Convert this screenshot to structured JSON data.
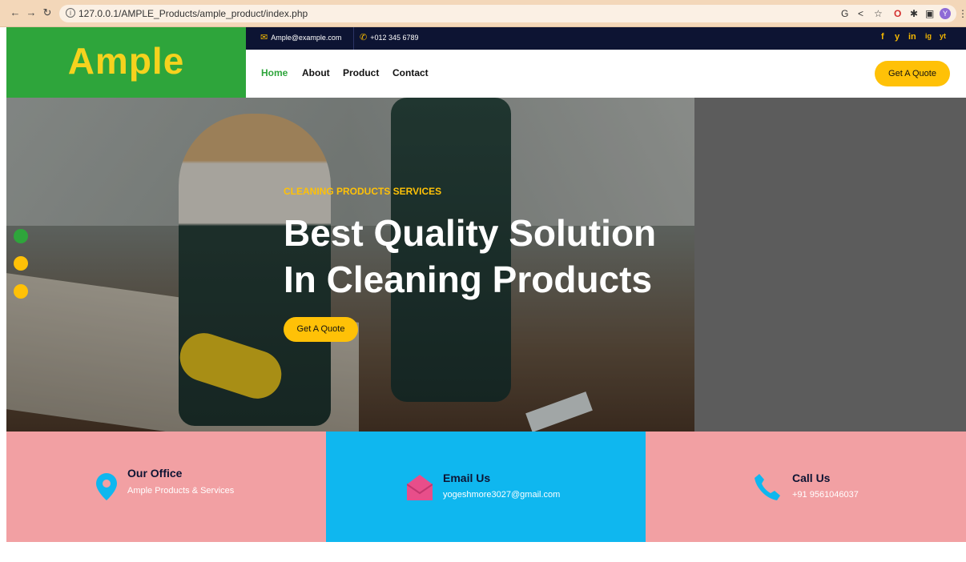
{
  "browser": {
    "url": "127.0.0.1/AMPLE_Products/ample_product/index.php",
    "avatar_initial": "Y"
  },
  "site": {
    "logo": "Ample",
    "topbar": {
      "email": "Ample@example.com",
      "phone": "+012 345 6789",
      "social": [
        "f",
        "y",
        "in",
        "ig",
        "yt"
      ]
    },
    "nav": {
      "links": [
        "Home",
        "About",
        "Product",
        "Contact"
      ],
      "active": "Home",
      "cta": "Get A Quote"
    },
    "hero": {
      "subtitle": "CLEANING PRODUCTS SERVICES",
      "title_line1": "Best Quality Solution",
      "title_line2": "In Cleaning Products",
      "button": "Get A Quote",
      "carousel_dots": 3,
      "active_dot": 0
    },
    "info": [
      {
        "title": "Our Office",
        "text": "Ample Products & Services",
        "icon": "location-pin-icon",
        "bg": "#f2a0a3"
      },
      {
        "title": "Email Us",
        "text": "yogeshmore3027@gmail.com",
        "icon": "envelope-open-icon",
        "bg": "#0fb7ef"
      },
      {
        "title": "Call Us",
        "text": "+91 9561046037",
        "icon": "phone-icon",
        "bg": "#f2a0a3"
      }
    ]
  },
  "colors": {
    "green": "#2ea53b",
    "yellow": "#ffc107",
    "navy": "#0d1433",
    "pink": "#f2a0a3",
    "blue": "#0fb7ef"
  }
}
